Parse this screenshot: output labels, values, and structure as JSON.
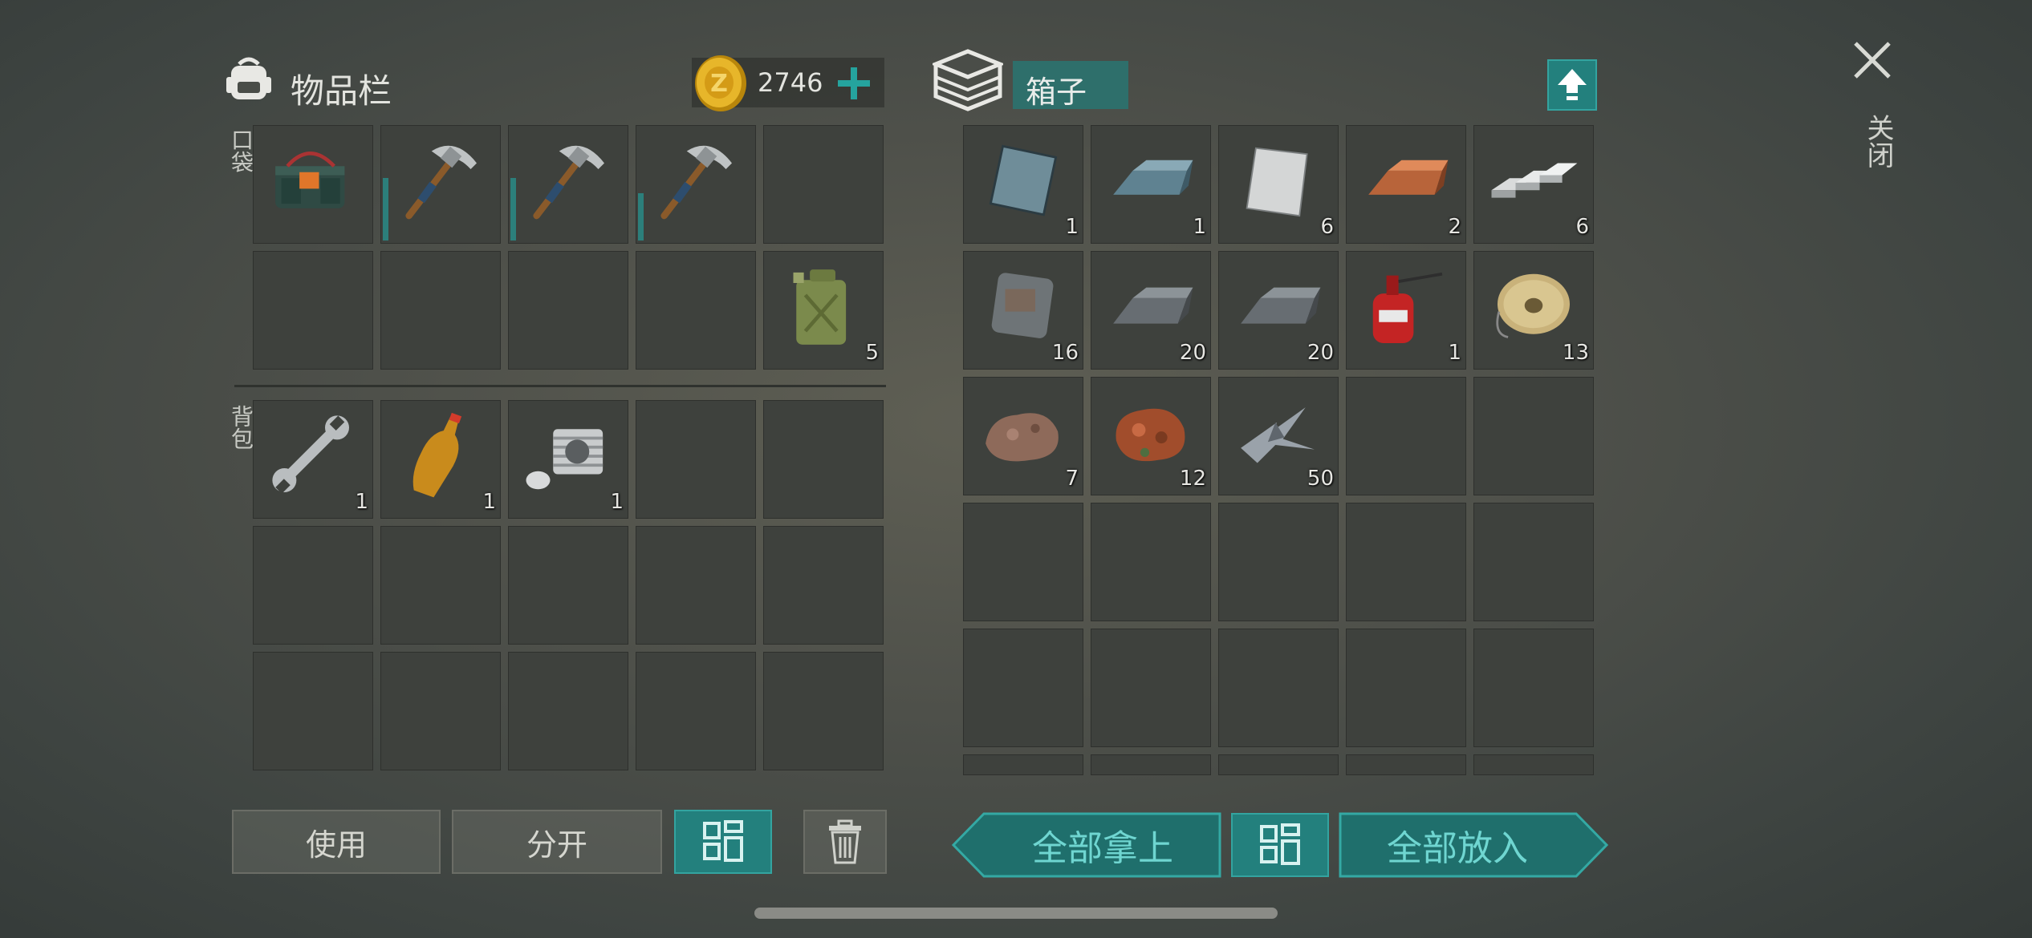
{
  "inventory": {
    "title": "物品栏",
    "currency": "2746",
    "pocket_label": "口袋",
    "backpack_label": "背包",
    "pocket_slots": [
      {
        "item": "explosive-pack",
        "count": ""
      },
      {
        "item": "pickaxe",
        "count": "",
        "durability": 0.6
      },
      {
        "item": "pickaxe",
        "count": "",
        "durability": 0.6
      },
      {
        "item": "pickaxe",
        "count": "",
        "durability": 0.45
      },
      {
        "item": "",
        "count": ""
      },
      {
        "item": "",
        "count": ""
      },
      {
        "item": "",
        "count": ""
      },
      {
        "item": "",
        "count": ""
      },
      {
        "item": "",
        "count": ""
      },
      {
        "item": "jerrycan",
        "count": "5"
      }
    ],
    "backpack_slots": [
      {
        "item": "wrench",
        "count": "1"
      },
      {
        "item": "bottle",
        "count": "1"
      },
      {
        "item": "engine-cylinder",
        "count": "1"
      },
      {
        "item": "",
        "count": ""
      },
      {
        "item": "",
        "count": ""
      },
      {
        "item": "",
        "count": ""
      },
      {
        "item": "",
        "count": ""
      },
      {
        "item": "",
        "count": ""
      },
      {
        "item": "",
        "count": ""
      },
      {
        "item": "",
        "count": ""
      },
      {
        "item": "",
        "count": ""
      },
      {
        "item": "",
        "count": ""
      },
      {
        "item": "",
        "count": ""
      },
      {
        "item": "",
        "count": ""
      },
      {
        "item": "",
        "count": ""
      }
    ],
    "buttons": {
      "use": "使用",
      "split": "分开"
    }
  },
  "box": {
    "title": "箱子",
    "slots": [
      {
        "item": "steel-plate",
        "count": "1"
      },
      {
        "item": "steel-ingot",
        "count": "1"
      },
      {
        "item": "aluminum-sheet",
        "count": "6"
      },
      {
        "item": "copper-ingot",
        "count": "2"
      },
      {
        "item": "aluminum-bars",
        "count": "6"
      },
      {
        "item": "iron-plate",
        "count": "16"
      },
      {
        "item": "iron-ingot",
        "count": "20"
      },
      {
        "item": "iron-ingot",
        "count": "20"
      },
      {
        "item": "oil-can",
        "count": "1"
      },
      {
        "item": "wire-spool",
        "count": "13"
      },
      {
        "item": "iron-ore",
        "count": "7"
      },
      {
        "item": "copper-ore",
        "count": "12"
      },
      {
        "item": "scrap-metal",
        "count": "50"
      },
      {
        "item": "",
        "count": ""
      },
      {
        "item": "",
        "count": ""
      },
      {
        "item": "",
        "count": ""
      },
      {
        "item": "",
        "count": ""
      },
      {
        "item": "",
        "count": ""
      },
      {
        "item": "",
        "count": ""
      },
      {
        "item": "",
        "count": ""
      },
      {
        "item": "",
        "count": ""
      },
      {
        "item": "",
        "count": ""
      },
      {
        "item": "",
        "count": ""
      },
      {
        "item": "",
        "count": ""
      },
      {
        "item": "",
        "count": ""
      }
    ],
    "buttons": {
      "take_all": "全部拿上",
      "put_all": "全部放入"
    }
  },
  "close_label": "关闭",
  "colors": {
    "teal": "#23807d",
    "teal_text": "#6fd6d1",
    "slot": "#3e413d"
  }
}
